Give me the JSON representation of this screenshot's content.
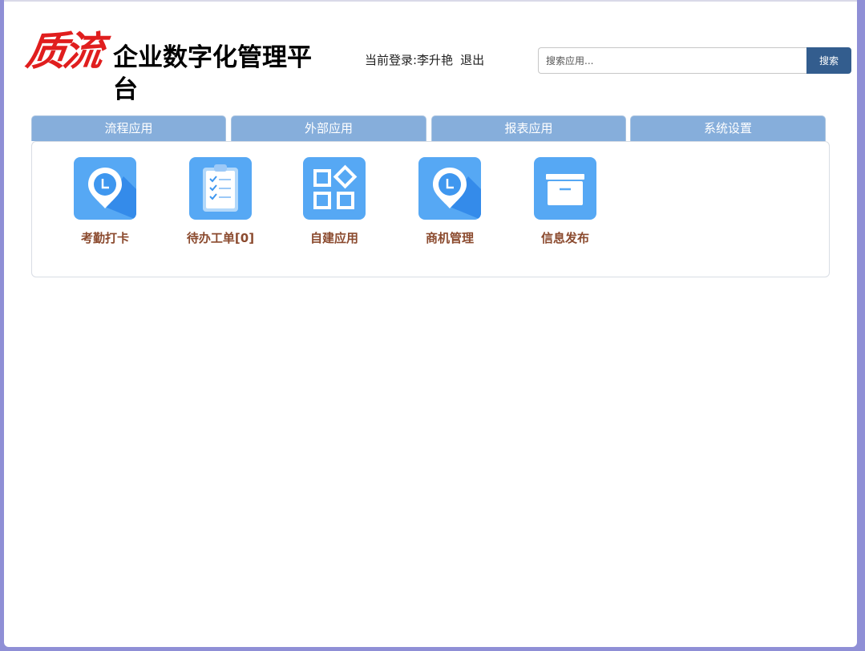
{
  "header": {
    "logo_mark": "质流",
    "title": "企业数字化管理平台",
    "login_label": "当前登录:李升艳",
    "logout_label": "退出"
  },
  "search": {
    "placeholder": "搜索应用...",
    "button_label": "搜索"
  },
  "tabs": [
    {
      "label": "流程应用"
    },
    {
      "label": "外部应用"
    },
    {
      "label": "报表应用"
    },
    {
      "label": "系统设置"
    }
  ],
  "apps": [
    {
      "label": "考勤打卡",
      "icon": "location-clock-icon"
    },
    {
      "label": "待办工单[0]",
      "icon": "clipboard-checklist-icon"
    },
    {
      "label": "自建应用",
      "icon": "apps-grid-icon"
    },
    {
      "label": "商机管理",
      "icon": "location-clock-icon"
    },
    {
      "label": "信息发布",
      "icon": "archive-box-icon"
    }
  ],
  "colors": {
    "tab_background": "#86aedb",
    "search_button": "#335d8e",
    "app_icon": "#56a8f4",
    "app_label": "#8b4a2e",
    "outer_background": "#8f8fd6"
  }
}
